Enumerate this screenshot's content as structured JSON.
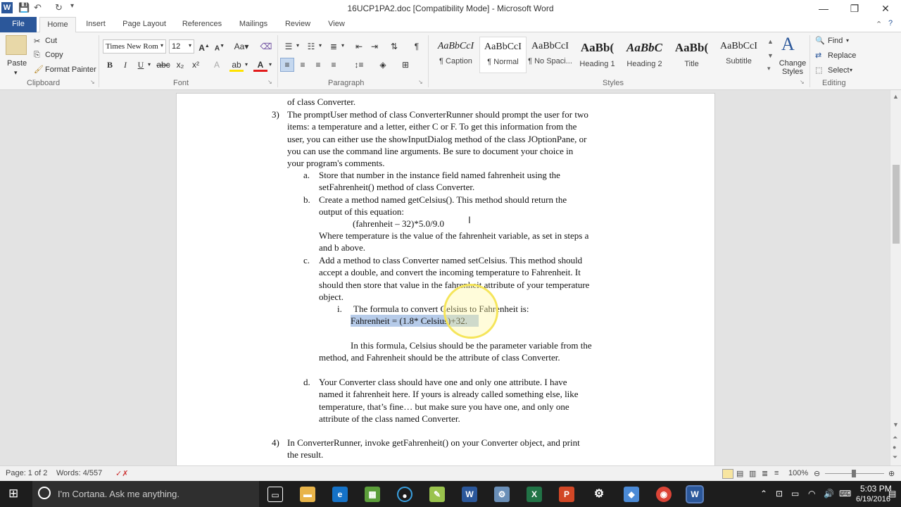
{
  "window": {
    "title": "16UCP1PA2.doc [Compatibility Mode] - Microsoft Word",
    "app_icon": "W",
    "minimize": "—",
    "maximize": "❐",
    "close": "✕"
  },
  "tabs": [
    "File",
    "Home",
    "Insert",
    "Page Layout",
    "References",
    "Mailings",
    "Review",
    "View"
  ],
  "clipboard": {
    "paste": "Paste",
    "cut": "Cut",
    "copy": "Copy",
    "format_painter": "Format Painter",
    "label": "Clipboard"
  },
  "font": {
    "family": "Times New Rom",
    "size": "12",
    "label": "Font"
  },
  "paragraph": {
    "label": "Paragraph"
  },
  "styles": {
    "label": "Styles",
    "items": [
      {
        "sample": "AaBbCcI",
        "name": "¶ Caption"
      },
      {
        "sample": "AaBbCcI",
        "name": "¶ Normal"
      },
      {
        "sample": "AaBbCcI",
        "name": "¶ No Spaci..."
      },
      {
        "sample": "AaBb(",
        "name": "Heading 1"
      },
      {
        "sample": "AaBbC",
        "name": "Heading 2"
      },
      {
        "sample": "AaBb(",
        "name": "Title"
      },
      {
        "sample": "AaBbCcI",
        "name": "Subtitle"
      }
    ],
    "change_styles": "Change Styles"
  },
  "editing": {
    "find": "Find",
    "replace": "Replace",
    "select": "Select",
    "label": "Editing"
  },
  "document": {
    "lines": [
      "of class Converter.",
      "3)",
      "The promptUser method of class ConverterRunner should prompt the user for two",
      "items: a temperature and a letter, either C or F.   To get this information from the",
      "user, you can either use the showInputDialog method of the class JOptionPane, or",
      "you can use the command line arguments.  Be sure to document your choice in",
      "your program's  comments.",
      "a.",
      " Store that number in the instance field named fahrenheit using the",
      "setFahrenheit() method of class Converter.",
      "b.",
      "Create a method named getCelsius().  This method should return the",
      "output of this equation:",
      "(fahrenheit – 32)*5.0/9.0",
      "Where temperature is the value of the fahrenheit variable, as set in steps a",
      "and b above.",
      "c.",
      "Add a method to class Converter named setCelsius.  This method should",
      "accept a double, and convert the incoming temperature to Fahrenheit.  It",
      "should then store that value in the fahrenheit attribute of your temperature",
      "object.",
      "i.",
      "The formula to convert Celsius to Fahrenheit is:",
      "Fahrenheit = (1.8* Celsius)+32.",
      "In this formula, Celsius should be the parameter variable from the",
      "method, and Fahrenheit  should be the attribute of class Converter.",
      "d.",
      "Your Converter class should have one and only one attribute.  I have",
      "named it fahrenheit here.  If yours is already called something else, like",
      "temperature, that’s fine… but make sure you have one, and only one",
      "attribute of the class named Converter.",
      "4)",
      "In ConverterRunner, invoke getFahrenheit() on your Converter object, and print",
      "the result."
    ]
  },
  "status": {
    "page": "Page: 1 of 2",
    "words": "Words: 4/557",
    "zoom": "100%"
  },
  "taskbar": {
    "search_placeholder": "I'm Cortana. Ask me anything.",
    "time": "5:03 PM",
    "date": "6/19/2016"
  }
}
